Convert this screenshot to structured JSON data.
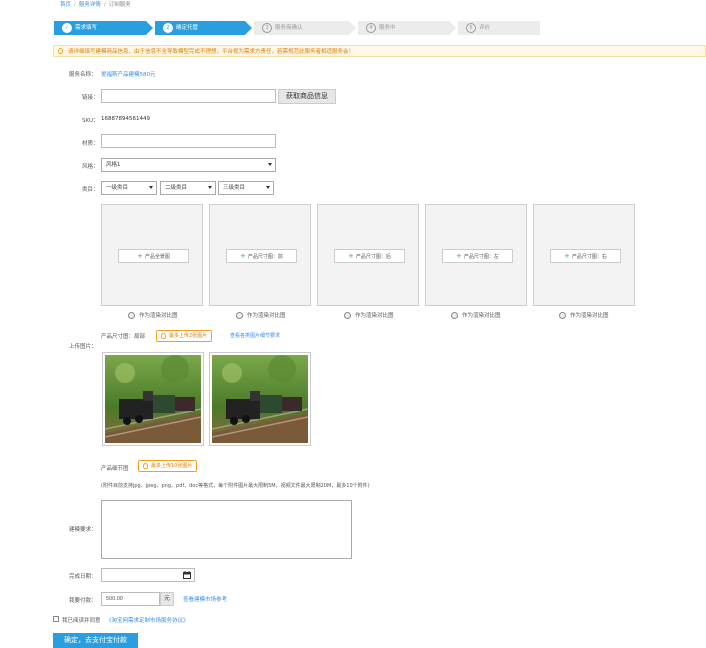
{
  "breadcrumb": {
    "home": "首页",
    "detail": "服务详情",
    "current": "订制服务"
  },
  "steps": [
    {
      "num": "✓",
      "label": "需求填写"
    },
    {
      "num": "2",
      "label": "确定托管"
    },
    {
      "num": "3",
      "label": "服务商确认"
    },
    {
      "num": "4",
      "label": "服务中"
    },
    {
      "num": "5",
      "label": "评价"
    }
  ],
  "notice": "请详细填写建模商品信息，由于信息不全导致模型完成不理想，平台视为需求方责任，若需规范此服务者相适服务会！",
  "service": {
    "label": "服务名称：",
    "value": "爱福斯产品建模580元"
  },
  "link_field": {
    "label": "链接：",
    "value": "",
    "button": "获取商品信息"
  },
  "sku": {
    "label": "SKU：",
    "value": "16887894561449"
  },
  "material": {
    "label": "材质：",
    "value": ""
  },
  "style": {
    "label": "风格：",
    "value": "风格1"
  },
  "category": {
    "label": "类目：",
    "options": [
      "一级类目",
      "二级类目",
      "三级类目"
    ]
  },
  "image_slots": [
    {
      "label": "产品全景图",
      "radio": "作为渲染对比图"
    },
    {
      "label": "产品尺寸图：前",
      "radio": "作为渲染对比图"
    },
    {
      "label": "产品尺寸图：后",
      "radio": "作为渲染对比图"
    },
    {
      "label": "产品尺寸图：左",
      "radio": "作为渲染对比图"
    },
    {
      "label": "产品尺寸图：右",
      "radio": "作为渲染对比图"
    }
  ],
  "upload": {
    "label": "上传图片：",
    "dim_label": "产品尺寸图：局部",
    "dim_tip": "最多上传2张图片",
    "dim_link": "查看各类图片细节要求",
    "detail_label": "产品细节图",
    "detail_tip": "最多上传10张图片",
    "note": "(附件目前支持jpg、jpeg、png、pdf、doc等格式，每个附件图片最大限制5M，视频文件最大限制20M，最多10个附件)"
  },
  "requirements": {
    "label": "建模要求：",
    "value": ""
  },
  "completion": {
    "label": "完成日期：",
    "value": ""
  },
  "payment": {
    "label": "我要付款：",
    "value": "500.00",
    "unit": "元",
    "link": "查看建模市场参考"
  },
  "agreement": {
    "text": "我已阅读并同意",
    "link": "《淘宝网需求定制市场服务协议》"
  },
  "submit": "确定，去支付宝付款",
  "colors": {
    "accent": "#2a9fe0",
    "warn": "#e07b00"
  }
}
